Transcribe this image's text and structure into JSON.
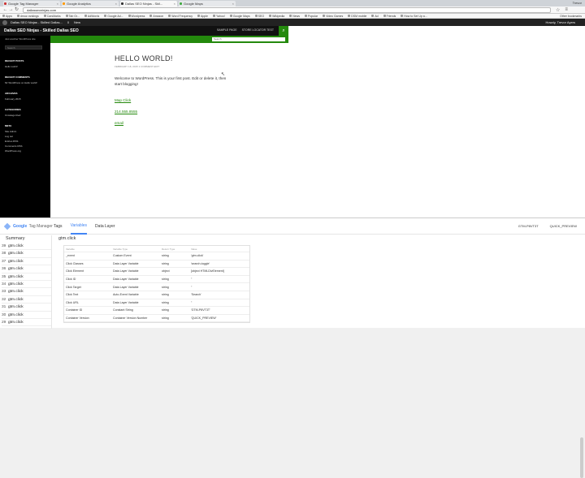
{
  "browser": {
    "tabs": [
      {
        "label": "Google Tag Manager",
        "active": false
      },
      {
        "label": "Google Analytics",
        "active": false
      },
      {
        "label": "Dallas SEO Ninjas - Skil...",
        "active": true
      },
      {
        "label": "Google Maps",
        "active": false
      }
    ],
    "user": "Trevor",
    "address": "dallasseoninjas.com",
    "bookmarks": [
      "Apps",
      "dmoz rankings",
      "CarsMarks",
      "Tab Gr...",
      "AdWords",
      "Google Ad...",
      "Wordpress",
      "Amazon",
      "Word Frequency",
      "Apple",
      "Yahoo!",
      "Google Maps",
      "SEO",
      "Wikipedia",
      "News",
      "Popular",
      "Video Games",
      "DSM mobile",
      "Ad",
      "Friends",
      "How to Set Up a..."
    ],
    "bookmarks_other": "Other bookmarks"
  },
  "wp_admin_bar": {
    "items": [
      "Dallas SEO Ninjas - Skilled Dallas...",
      "0",
      "New"
    ],
    "howdy": "Howdy, Trevor Ayers"
  },
  "site": {
    "title": "Dallas SEO Ninjas - Skilled Dallas SEO",
    "tagline": "Just another WordPress site",
    "nav": [
      "SAMPLE PAGE",
      "STORE LOCATOR TEST"
    ],
    "search_placeholder": "Search",
    "sidebar": {
      "search_placeholder": "Search",
      "recent_posts_h": "RECENT POSTS",
      "recent_posts": [
        "Hello world!"
      ],
      "recent_comments_h": "RECENT COMMENTS",
      "recent_comments": [
        "Mr WordPress on Hello world!"
      ],
      "archives_h": "ARCHIVES",
      "archives": [
        "February 2015"
      ],
      "categories_h": "CATEGORIES",
      "categories": [
        "Uncategorized"
      ],
      "meta_h": "META",
      "meta": [
        "Site Admin",
        "Log out",
        "Entries RSS",
        "Comments RSS",
        "WordPress.org"
      ]
    },
    "post": {
      "title": "HELLO WORLD!",
      "meta": "FEBRUARY 18, 2015   1 COMMENT   EDIT",
      "body": "Welcome to WordPress. This is your first post. Edit or delete it, then start blogging!",
      "links": [
        "Map Click",
        "214.555.8555",
        "email"
      ]
    }
  },
  "gtm": {
    "logo_g": "Google",
    "logo_text": "Tag Manager",
    "tabs": [
      "Tags",
      "Variables",
      "Data Layer"
    ],
    "active_tab": "Variables",
    "right": [
      "GTM-P8VT3T",
      "QUICK_PREVIEW"
    ],
    "summary_title": "Summary",
    "events": [
      {
        "num": "39",
        "label": "gtm.click"
      },
      {
        "num": "38",
        "label": "gtm.click"
      },
      {
        "num": "37",
        "label": "gtm.click"
      },
      {
        "num": "36",
        "label": "gtm.click"
      },
      {
        "num": "35",
        "label": "gtm.click"
      },
      {
        "num": "34",
        "label": "gtm.click"
      },
      {
        "num": "33",
        "label": "gtm.click"
      },
      {
        "num": "32",
        "label": "gtm.click"
      },
      {
        "num": "31",
        "label": "gtm.click"
      },
      {
        "num": "30",
        "label": "gtm.click"
      },
      {
        "num": "29",
        "label": "gtm.click"
      }
    ],
    "detail_title": "gtm.click",
    "table_headers": [
      "Variable",
      "Variable Type",
      "Return Type",
      "Value"
    ],
    "rows": [
      [
        "_event",
        "Custom Event",
        "string",
        "'gtm.click'"
      ],
      [
        "Click Classes",
        "Data Layer Variable",
        "string",
        "'search-toggle'"
      ],
      [
        "Click Element",
        "Data Layer Variable",
        "object",
        "[object HTMLDivElement]"
      ],
      [
        "Click ID",
        "Data Layer Variable",
        "string",
        "''"
      ],
      [
        "Click Target",
        "Data Layer Variable",
        "string",
        "''"
      ],
      [
        "Click Text",
        "Auto-Event Variable",
        "string",
        "'Search'"
      ],
      [
        "Click URL",
        "Data Layer Variable",
        "string",
        "''"
      ],
      [
        "Container ID",
        "Constant String",
        "string",
        "'GTM-P8VT3T'"
      ],
      [
        "Container Version",
        "Container Version Number",
        "string",
        "'QUICK_PREVIEW'"
      ]
    ]
  }
}
